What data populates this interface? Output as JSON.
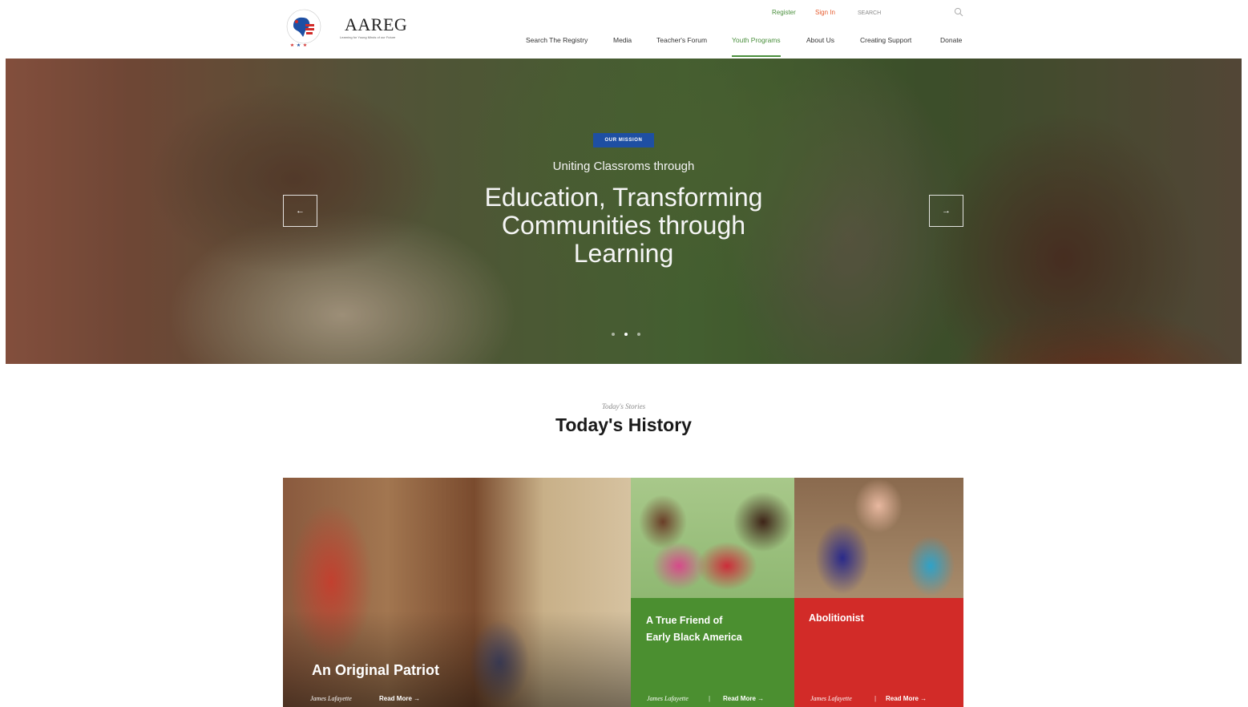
{
  "header": {
    "logo": {
      "name": "AAREG",
      "tagline": "Learning for Young Minds of our Future",
      "seal_text": "AFRICAN AMERICAN REGISTRY"
    },
    "utility": {
      "register": "Register",
      "sign_in": "Sign In",
      "search_placeholder": "SEARCH"
    },
    "nav": [
      {
        "label": "Search The Registry",
        "active": false
      },
      {
        "label": "Media",
        "active": false
      },
      {
        "label": "Teacher's Forum",
        "active": false
      },
      {
        "label": "Youth Programs",
        "active": true
      },
      {
        "label": "About Us",
        "active": false
      },
      {
        "label": "Creating Support",
        "active": false
      },
      {
        "label": "Donate",
        "active": false
      }
    ]
  },
  "hero": {
    "badge": "OUR MISSION",
    "subtitle": "Uniting Classroms through",
    "title": "Education, Transforming Communities through Learning",
    "prev": "←",
    "next": "→",
    "slide_count": 3,
    "active_slide": 2
  },
  "section": {
    "kicker": "Today's Stories",
    "title": "Today's History"
  },
  "cards": [
    {
      "title": "An Original Patriot",
      "author": "James Lafayette",
      "read_more": "Read More →"
    },
    {
      "title": "A True Friend of Early Black America",
      "author": "James Lafayette",
      "separator": "|",
      "read_more": "Read More →",
      "color": "#4b8f30"
    },
    {
      "title": "Abolitionist",
      "author": "James Lafayette",
      "separator": "|",
      "read_more": "Read More →",
      "color": "#d22b28"
    }
  ],
  "colors": {
    "brand_blue": "#1e4fa3",
    "green": "#4b8f30",
    "red": "#d22b28",
    "accent_orange": "#e65b2e"
  }
}
